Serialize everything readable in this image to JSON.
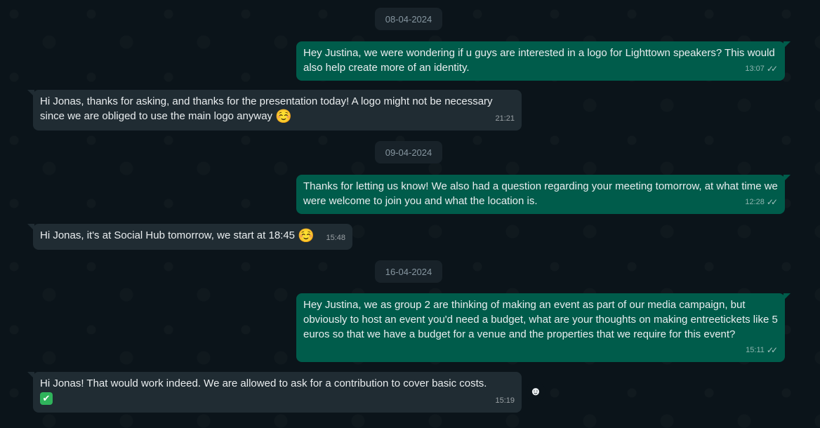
{
  "dates": [
    "08-04-2024",
    "09-04-2024",
    "16-04-2024"
  ],
  "messages": [
    {
      "text": "Hey Justina, we were wondering if u guys are interested in a logo for Lighttown speakers? This would also help create more of an identity.",
      "time": "13:07",
      "direction": "out"
    },
    {
      "text": "Hi Jonas, thanks for asking, and thanks for the presentation today! A logo might not be necessary since we are obliged to use the main logo anyway",
      "emoji": "☺️",
      "time": "21:21",
      "direction": "in"
    },
    {
      "text": "Thanks for letting us know! We also had a question regarding your meeting tomorrow, at what time we were welcome to join you and what the location is.",
      "time": "12:28",
      "direction": "out"
    },
    {
      "text": "Hi Jonas, it's at Social Hub tomorrow, we start at 18:45",
      "emoji": "☺️",
      "time": "15:48",
      "direction": "in"
    },
    {
      "text": "Hey Justina, we as group 2 are thinking of making an event as part of our media campaign, but obviously to host an event you'd need a budget, what are your thoughts on making entreetickets like 5 euros so that we have a budget for a venue and the properties that we require for this event?",
      "time": "15:11",
      "direction": "out"
    },
    {
      "text": "Hi Jonas! That would work indeed. We are allowed to ask for a contribution to cover basic costs.",
      "emoji": "✔",
      "time": "15:19",
      "direction": "in"
    }
  ],
  "icons": {
    "read_receipt": "double-check-icon",
    "react": "emoji-smiley-icon"
  },
  "colors": {
    "background": "#0b141a",
    "outgoing": "#005c4b",
    "incoming": "#202c33",
    "date_chip": "#182229"
  }
}
